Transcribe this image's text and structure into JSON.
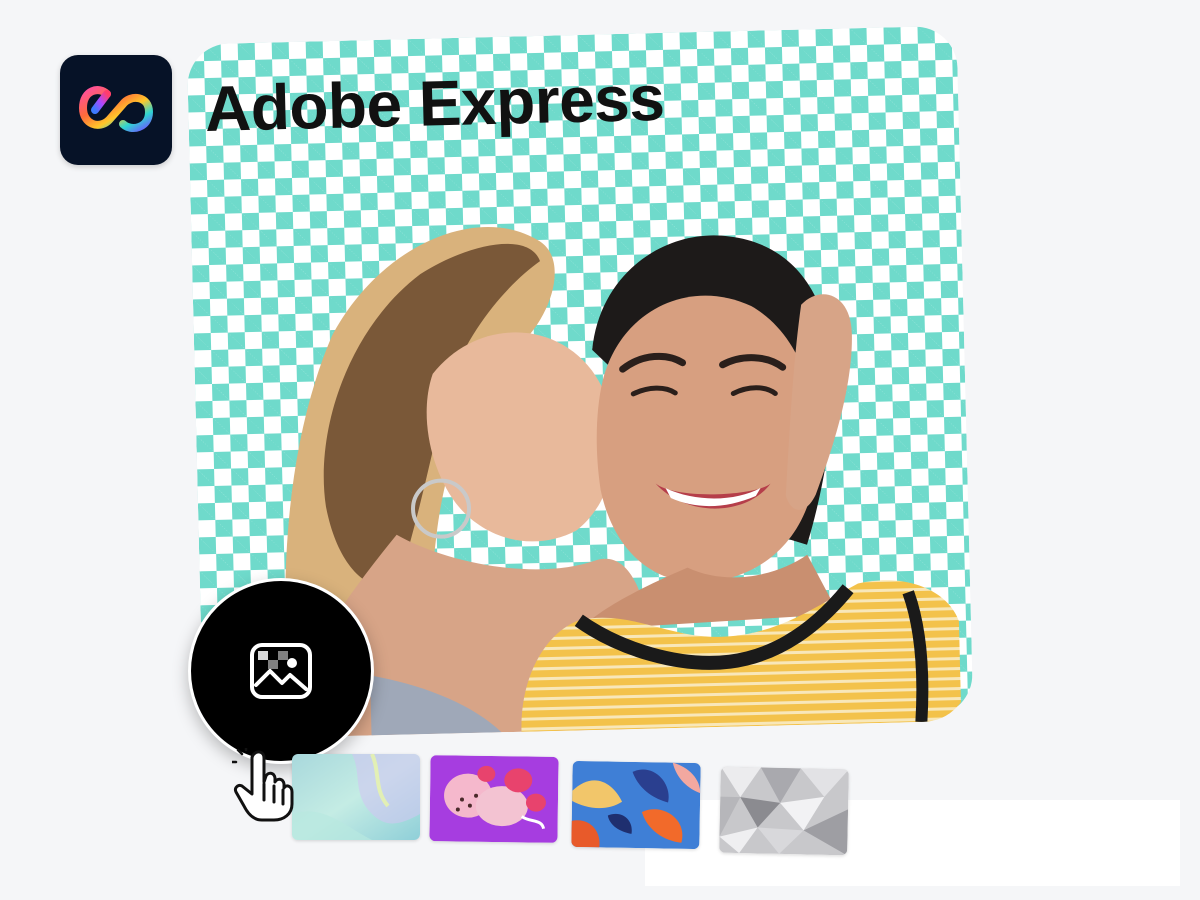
{
  "app": {
    "title": "Adobe Express",
    "logo_icon": "adobe-express-logo-icon",
    "logo_bg": "#061227"
  },
  "canvas": {
    "checker_color": "#6fdacb",
    "checker_alt": "#ffffff"
  },
  "controls": {
    "background_button_icon": "image-icon",
    "cursor_icon": "hand-pointer-icon"
  },
  "thumbnails": [
    {
      "name": "holographic-gradient",
      "colors": [
        "#9fd3d6",
        "#bfe9e2",
        "#c7c6f0",
        "#a9dfe8"
      ]
    },
    {
      "name": "pink-floral-purple",
      "colors": [
        "#a63de0",
        "#f3b1c8",
        "#e8436d",
        "#ffffff"
      ]
    },
    {
      "name": "tropical-leaves-blue",
      "colors": [
        "#3f7fd6",
        "#f26a2a",
        "#f2c66a",
        "#2a3f8f"
      ]
    },
    {
      "name": "silver-crystal",
      "colors": [
        "#d7d7d9",
        "#a9a9ae",
        "#ececee",
        "#8b8b90"
      ]
    }
  ]
}
